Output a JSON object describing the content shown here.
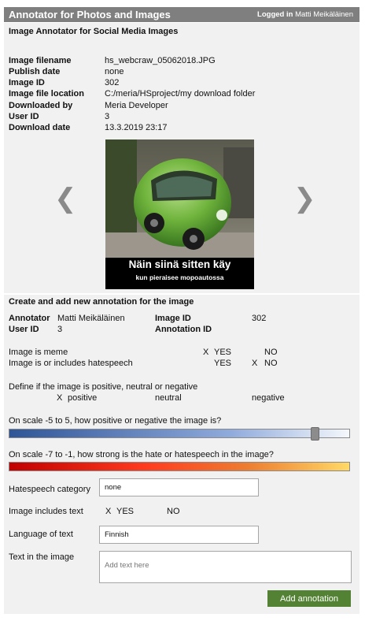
{
  "header": {
    "title": "Annotator for Photos and Images",
    "logged_in_label": "Logged in",
    "user_name": "Matti Meikäläinen"
  },
  "image_section": {
    "title": "Image Annotator for Social Media Images",
    "fields": [
      {
        "label": "Image filename",
        "value": "hs_webcraw_05062018.JPG"
      },
      {
        "label": "Publish date",
        "value": "none"
      },
      {
        "label": "Image ID",
        "value": "302"
      },
      {
        "label": "Image file location",
        "value": "C:/meria/HSproject/my download folder"
      },
      {
        "label": "Downloaded by",
        "value": "Meria Developer"
      },
      {
        "label": "User ID",
        "value": "3"
      },
      {
        "label": "Download date",
        "value": "13.3.2019 23:17"
      }
    ],
    "image": {
      "caption_main": "Näin siinä sitten käy",
      "caption_sub": "kun pieraisee mopoautossa"
    },
    "prev_icon": "chevron-left-icon",
    "next_icon": "chevron-right-icon",
    "prev_glyph": "❮",
    "next_glyph": "❯"
  },
  "annotation": {
    "title": "Create and add new annotation for the image",
    "annotator_label": "Annotator",
    "annotator_value": "Matti Meikäläinen",
    "user_id_label": "User ID",
    "user_id_value": "3",
    "image_id_label": "Image ID",
    "image_id_value": "302",
    "annotation_id_label": "Annotation ID",
    "annotation_id_value": "",
    "meme": {
      "label": "Image is meme",
      "yes_mark": "X",
      "yes": "YES",
      "no_mark": "",
      "no": "NO"
    },
    "hate": {
      "label": "Image is or includes hatespeech",
      "yes_mark": "",
      "yes": "YES",
      "no_mark": "X",
      "no": "NO"
    },
    "sentiment": {
      "label": "Define if the image is positive, neutral or negative",
      "selected_mark": "X",
      "positive": "positive",
      "neutral": "neutral",
      "negative": "negative"
    },
    "scale_positive": {
      "label": "On scale -5 to 5, how positive or negative the image is?",
      "min": -5,
      "max": 5,
      "value": 4.1
    },
    "scale_hate": {
      "label": "On scale -7 to -1, how strong is the hate or hatespeech in the image?",
      "min": -7,
      "max": -1
    },
    "hatespeech_category": {
      "label": "Hatespeech category",
      "value": "none"
    },
    "includes_text": {
      "label": "Image includes text",
      "yes_mark": "X",
      "yes": "YES",
      "no": "NO"
    },
    "language": {
      "label": "Language of text",
      "value": "Finnish"
    },
    "text_in_image": {
      "label": "Text in the image",
      "placeholder": "Add text here"
    },
    "add_button": "Add annotation"
  },
  "colors": {
    "header_bg": "#7f7f7f",
    "panel_bg": "#f1f1f1",
    "button_bg": "#548235",
    "positive_scale": [
      "#2f5597",
      "#8faadc",
      "#f5f8fc"
    ],
    "hate_scale": [
      "#c00000",
      "#ff3b1f",
      "#ed7d31",
      "#ffd966"
    ]
  }
}
